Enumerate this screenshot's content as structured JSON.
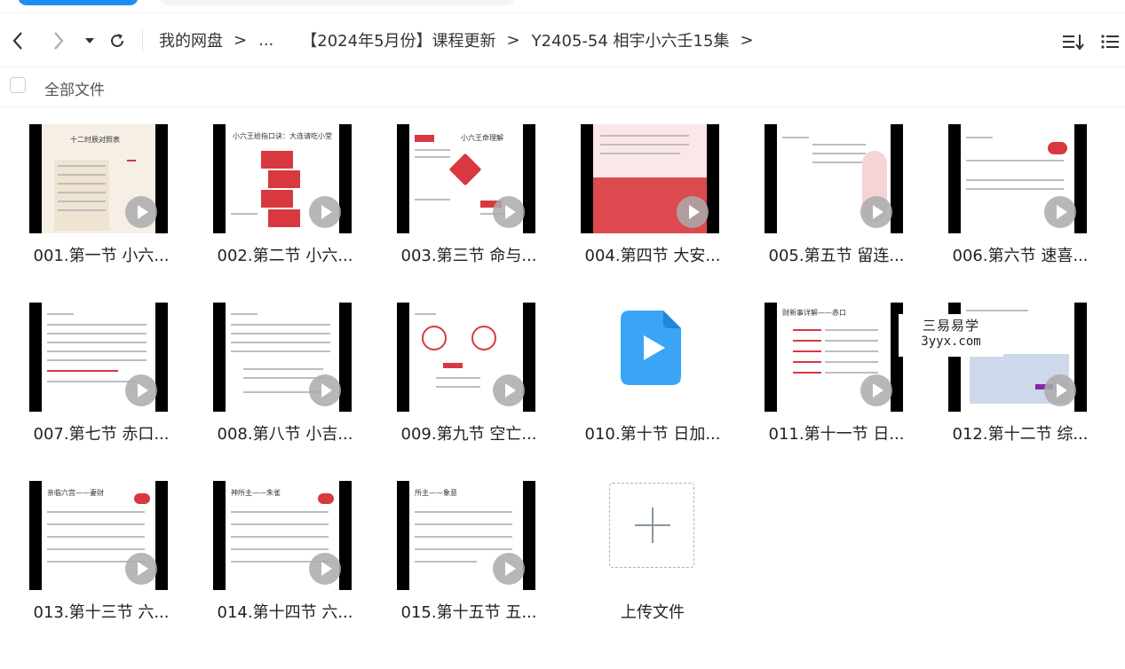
{
  "nav": {
    "breadcrumbs": [
      "我的网盘",
      "...",
      "【2024年5月份】课程更新",
      "Y2405-54 相宇小六壬15集"
    ],
    "sep": ">"
  },
  "select_bar": {
    "label": "全部文件"
  },
  "files": [
    {
      "name": "001.第一节 小六..."
    },
    {
      "name": "002.第二节 小六..."
    },
    {
      "name": "003.第三节 命与..."
    },
    {
      "name": "004.第四节 大安..."
    },
    {
      "name": "005.第五节 留连..."
    },
    {
      "name": "006.第六节 速喜..."
    },
    {
      "name": "007.第七节 赤口..."
    },
    {
      "name": "008.第八节 小吉..."
    },
    {
      "name": "009.第九节 空亡..."
    },
    {
      "name": "010.第十节 日加..."
    },
    {
      "name": "011.第十一节 日..."
    },
    {
      "name": "012.第十二节 综..."
    },
    {
      "name": "013.第十三节 六..."
    },
    {
      "name": "014.第十四节 六..."
    },
    {
      "name": "015.第十五节 五..."
    }
  ],
  "upload": {
    "label": "上传文件"
  },
  "watermark": {
    "line1": "三易易学",
    "line2": "3yyx.com"
  },
  "thumb_titles": {
    "t1": "十二时辰对照表",
    "t2": "小六王给指口诀：大连请吃小堂",
    "t3": "小六王命理解",
    "t5": "",
    "t11": "财新事详解——赤口",
    "t13": "亲临六宫——妻财",
    "t14": "神所主——朱雀",
    "t15": "所主——象意"
  },
  "colors": {
    "accent": "#1e8ef5",
    "video_icon": "#3aa5f7",
    "thumb_red": "#d8383f"
  }
}
